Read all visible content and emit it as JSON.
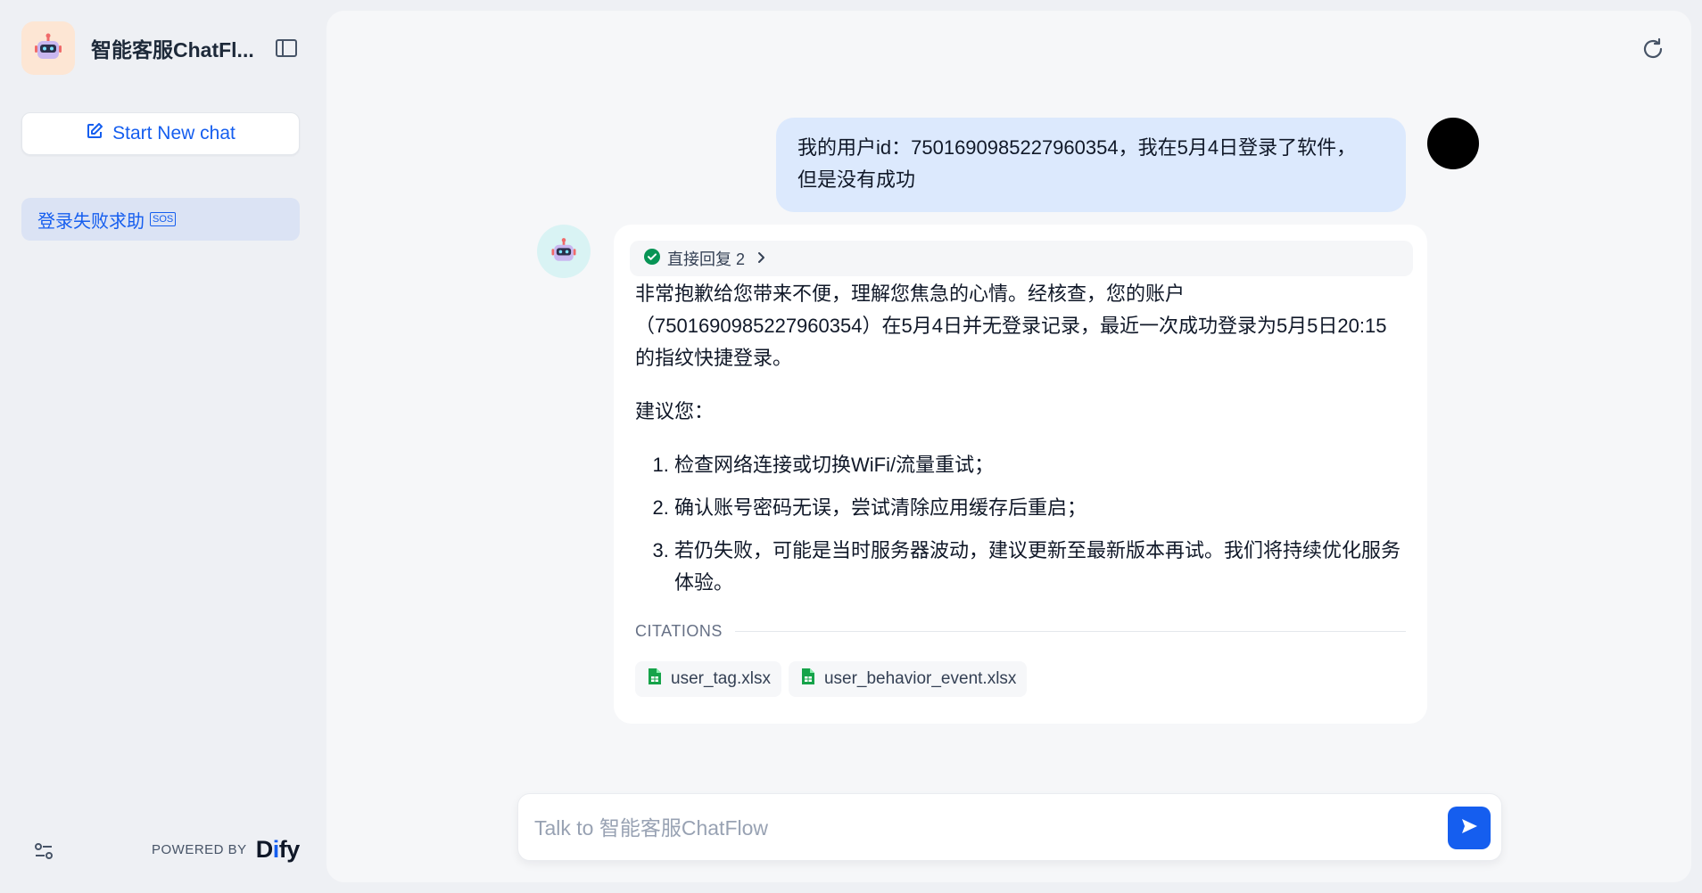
{
  "sidebar": {
    "app_title": "智能客服ChatFl...",
    "app_icon": "robot-icon",
    "new_chat_label": "Start New chat",
    "conversations": [
      {
        "title": "登录失败求助",
        "emoji": "SOS"
      }
    ],
    "powered_by_label": "POWERED BY",
    "brand_prefix": "D",
    "brand_i": "i",
    "brand_suffix": "fy"
  },
  "chat": {
    "user_message": {
      "line1": "我的用户id：7501690985227960354，我在5月4日登录了软件，",
      "line2": "但是没有成功"
    },
    "bot_message": {
      "workflow_label": "直接回复 2",
      "paragraph1": "非常抱歉给您带来不便，理解您焦急的心情。经核查，您的账户（7501690985227960354）在5月4日并无登录记录，最近一次成功登录为5月5日20:15的指纹快捷登录。",
      "paragraph2": "建议您：",
      "suggestions": [
        "检查网络连接或切换WiFi/流量重试；",
        "确认账号密码无误，尝试清除应用缓存后重启；",
        "若仍失败，可能是当时服务器波动，建议更新至最新版本再试。我们将持续优化服务体验。"
      ],
      "citations_label": "CITATIONS",
      "citations": [
        "user_tag.xlsx",
        "user_behavior_event.xlsx"
      ]
    }
  },
  "input": {
    "placeholder": "Talk to 智能客服ChatFlow",
    "value": ""
  },
  "colors": {
    "accent": "#155eef",
    "user_bubble": "#dce9fd",
    "sidebar_active": "#dbe3f4",
    "success": "#079455",
    "excel": "#16a34a"
  }
}
